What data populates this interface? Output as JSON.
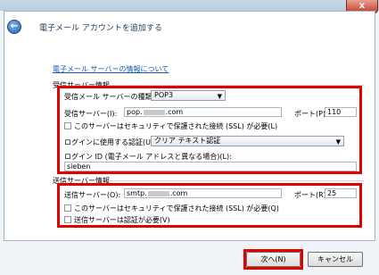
{
  "window": {
    "title": "電子メール アカウントを追加する",
    "close_glyph": "x",
    "back_glyph": "←"
  },
  "link": "電子メール サーバーの情報について",
  "incoming": {
    "section_label": "受信サーバー情報",
    "type_label": "受信メール サーバーの種類(M):",
    "type_value": "POP3",
    "server_label": "受信サーバー(I):",
    "server_prefix": "pop.",
    "server_suffix": ".com",
    "port_label": "ポート(P):",
    "port_value": "110",
    "ssl_label": "このサーバーはセキュリティで保護された接続 (SSL) が必要(L)",
    "auth_label": "ログインに使用する認証(U):",
    "auth_value": "クリア テキスト認証",
    "login_label": "ログイン ID (電子メール アドレスと異なる場合)(L):",
    "login_value": "sieben"
  },
  "outgoing": {
    "section_label": "送信サーバー情報",
    "server_label": "送信サーバー(O):",
    "server_prefix": "smtp.",
    "server_suffix": ".com",
    "port_label": "ポート(R):",
    "port_value": "25",
    "ssl_label": "このサーバーはセキュリティで保護された接続 (SSL) が必要(Q)",
    "auth_label": "送信サーバーは認証が必要(V)"
  },
  "buttons": {
    "next": "次へ(N)",
    "cancel": "キャンセル"
  },
  "colors": {
    "highlight": "#e00000",
    "link": "#1a56b8"
  }
}
